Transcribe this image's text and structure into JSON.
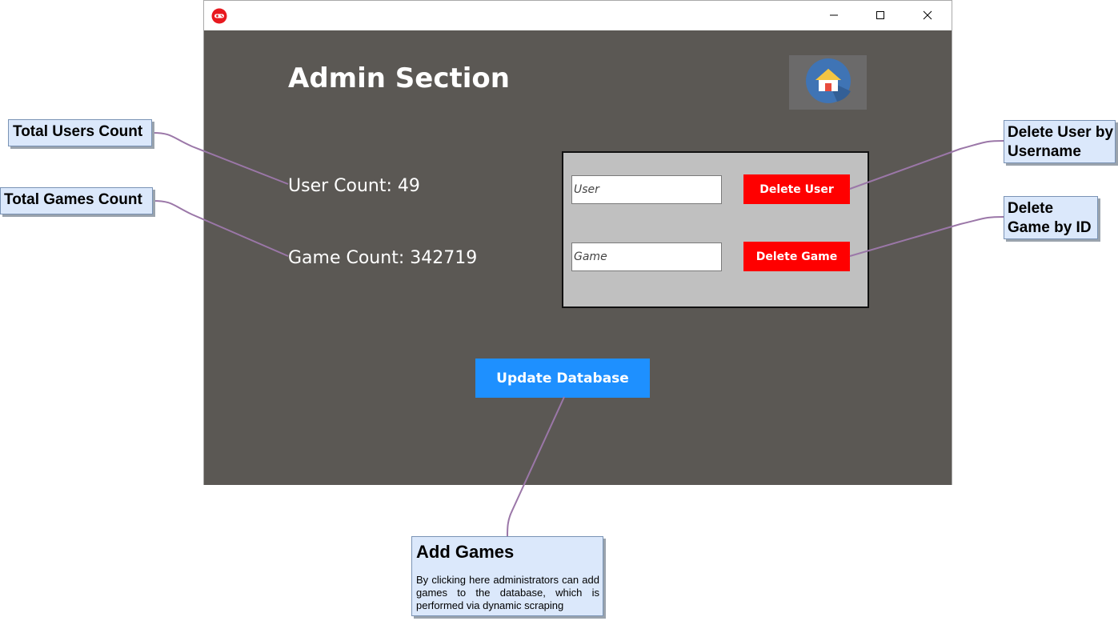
{
  "window": {
    "app_icon": "game-controller-icon",
    "controls": {
      "minimize_icon": "minimize-icon",
      "maximize_icon": "maximize-icon",
      "close_icon": "close-icon"
    }
  },
  "admin": {
    "title": "Admin Section",
    "home_icon": "home-icon",
    "user_count_label": "User Count: 49",
    "game_count_label": "Game Count: 342719",
    "delete_panel": {
      "user_placeholder": "User",
      "game_placeholder": "Game",
      "delete_user_label": "Delete User",
      "delete_game_label": "Delete Game"
    },
    "update_label": "Update Database"
  },
  "annotations": {
    "total_users": "Total Users Count",
    "total_games": "Total Games Count",
    "delete_user": "Delete User by Username",
    "delete_game": "Delete Game by ID",
    "add_games_title": "Add Games",
    "add_games_desc": "By clicking here administrators can add games to the database, which is performed via dynamic scraping"
  },
  "colors": {
    "window_background": "#5b5854",
    "panel_background": "#c0c0c0",
    "delete_buttons": "#ff0000",
    "update_button": "#1e90ff",
    "callout_fill": "#dbe8fb",
    "connector_line": "#9b77a8"
  }
}
